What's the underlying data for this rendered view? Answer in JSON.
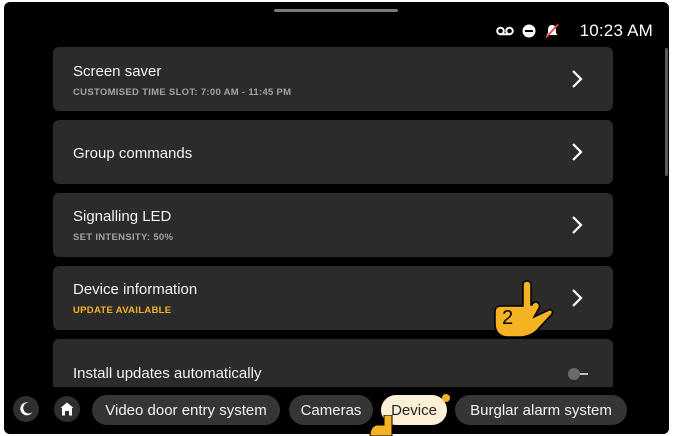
{
  "status": {
    "icons": [
      "voicemail-icon",
      "do-not-disturb-icon",
      "bell-off-icon"
    ],
    "time": "10:23 AM"
  },
  "settings": {
    "items": [
      {
        "title": "Screen saver",
        "subtitle": "CUSTOMISED TIME SLOT: 7:00 AM - 11:45 PM"
      },
      {
        "title": "Group commands",
        "subtitle": ""
      },
      {
        "title": "Signalling LED",
        "subtitle": "SET INTENSITY: 50%"
      },
      {
        "title": "Device information",
        "subtitle": "UPDATE AVAILABLE"
      },
      {
        "title": "Install updates automatically",
        "subtitle": ""
      }
    ],
    "accent_color": "#f5b324",
    "auto_update_enabled": false
  },
  "bottom_nav": {
    "round_buttons": [
      "moon-icon",
      "home-icon"
    ],
    "tabs": [
      {
        "label": "Video door entry system",
        "active": false
      },
      {
        "label": "Cameras",
        "active": false
      },
      {
        "label": "Device",
        "active": true
      },
      {
        "label": "Burglar alarm system",
        "active": false
      }
    ]
  },
  "annotation": {
    "step": "2"
  }
}
